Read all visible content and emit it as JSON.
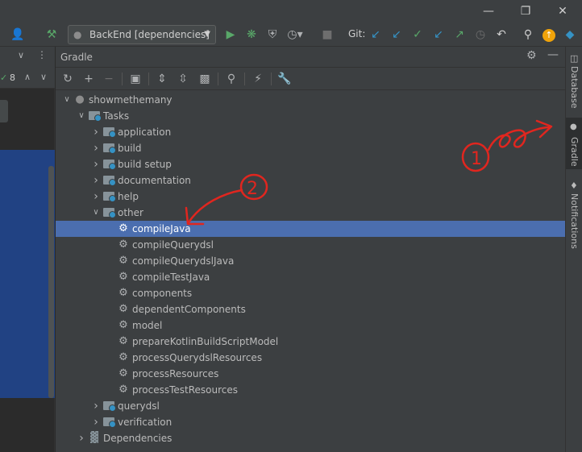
{
  "toolbar": {
    "run_config": "BackEnd [dependencies]",
    "git_label": "Git:",
    "icons": [
      "user-icon",
      "hammer-icon",
      "run-icon",
      "debug-icon",
      "coverage-icon",
      "profile-icon",
      "stop-icon",
      "git-update-icon",
      "git-pull-icon",
      "git-commit-icon",
      "git-push-icon",
      "git-history-icon",
      "undo-icon",
      "search-icon",
      "update-badge-icon",
      "toolbox-icon"
    ]
  },
  "left_panel": {
    "count": "8"
  },
  "gradle": {
    "title": "Gradle",
    "tree": [
      {
        "label": "showmethemany",
        "level": 0,
        "kind": "project",
        "expanded": true
      },
      {
        "label": "Tasks",
        "level": 1,
        "kind": "folder",
        "expanded": true
      },
      {
        "label": "application",
        "level": 2,
        "kind": "folder",
        "expanded": false
      },
      {
        "label": "build",
        "level": 2,
        "kind": "folder",
        "expanded": false
      },
      {
        "label": "build setup",
        "level": 2,
        "kind": "folder",
        "expanded": false
      },
      {
        "label": "documentation",
        "level": 2,
        "kind": "folder",
        "expanded": false
      },
      {
        "label": "help",
        "level": 2,
        "kind": "folder",
        "expanded": false
      },
      {
        "label": "other",
        "level": 2,
        "kind": "folder",
        "expanded": true
      },
      {
        "label": "compileJava",
        "level": 3,
        "kind": "task",
        "selected": true
      },
      {
        "label": "compileQuerydsl",
        "level": 3,
        "kind": "task"
      },
      {
        "label": "compileQuerydslJava",
        "level": 3,
        "kind": "task"
      },
      {
        "label": "compileTestJava",
        "level": 3,
        "kind": "task"
      },
      {
        "label": "components",
        "level": 3,
        "kind": "task"
      },
      {
        "label": "dependentComponents",
        "level": 3,
        "kind": "task"
      },
      {
        "label": "model",
        "level": 3,
        "kind": "task"
      },
      {
        "label": "prepareKotlinBuildScriptModel",
        "level": 3,
        "kind": "task"
      },
      {
        "label": "processQuerydslResources",
        "level": 3,
        "kind": "task"
      },
      {
        "label": "processResources",
        "level": 3,
        "kind": "task"
      },
      {
        "label": "processTestResources",
        "level": 3,
        "kind": "task"
      },
      {
        "label": "querydsl",
        "level": 2,
        "kind": "folder",
        "expanded": false
      },
      {
        "label": "verification",
        "level": 2,
        "kind": "folder",
        "expanded": false
      },
      {
        "label": "Dependencies",
        "level": 1,
        "kind": "deps",
        "expanded": false
      }
    ]
  },
  "right_sidebar": {
    "tabs": [
      {
        "label": "Database"
      },
      {
        "label": "Gradle"
      },
      {
        "label": "Notifications"
      }
    ]
  },
  "annotations": [
    {
      "text": "1",
      "color": "#e0261f"
    },
    {
      "text": "2",
      "color": "#e0261f"
    }
  ],
  "colors": {
    "selection": "#4b6eaf",
    "annotation": "#e0261f",
    "run_green": "#59a869",
    "git_blue": "#3592c4"
  }
}
